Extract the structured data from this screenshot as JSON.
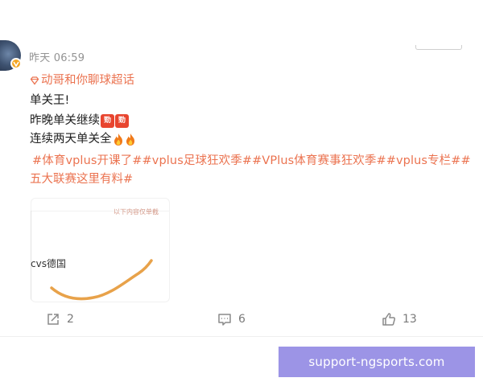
{
  "post": {
    "time": "昨天 06:59",
    "supertopic_label": "动哥和你聊球超话",
    "lines": [
      "单关王!",
      "昨晚单关继续",
      "连续两天单关全"
    ],
    "emoji_tags": [
      "勁",
      "勁"
    ],
    "hashtags_line1": "#体育vplus开课了##vplus足球狂欢季##VPlus体育赛事狂欢季##vplus专栏##",
    "hashtags_line2": "五大联赛这里有料#"
  },
  "thumbnail": {
    "note": "以下内容仅单截",
    "label": "cvs德国"
  },
  "actions": {
    "repost_count": "2",
    "comment_count": "6",
    "like_count": "13"
  },
  "watermark": {
    "text": "support-ngsports.com"
  },
  "colors": {
    "accent": "#eb7350",
    "watermark_bg": "#9c94e6",
    "curve": "#e8a24a"
  }
}
